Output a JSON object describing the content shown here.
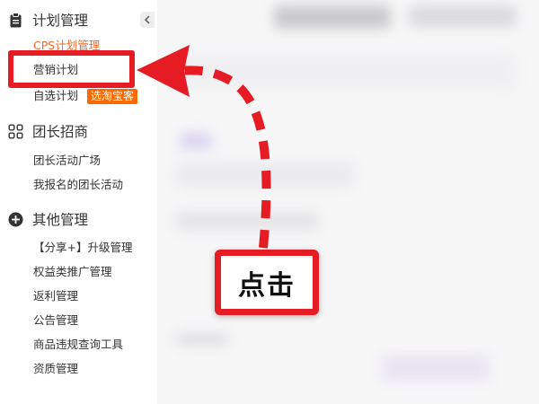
{
  "sidebar": {
    "sections": [
      {
        "title": "计划管理",
        "icon": "clipboard-icon",
        "items": [
          {
            "label": "CPS计划管理",
            "active": true
          },
          {
            "label": "营销计划",
            "highlighted": true
          },
          {
            "label": "自选计划",
            "tag": "选淘宝客"
          }
        ]
      },
      {
        "title": "团长招商",
        "icon": "grid-icon",
        "items": [
          {
            "label": "团长活动广场"
          },
          {
            "label": "我报名的团长活动"
          }
        ]
      },
      {
        "title": "其他管理",
        "icon": "plus-circle-icon",
        "items": [
          {
            "label": "【分享+】升级管理"
          },
          {
            "label": "权益类推广管理"
          },
          {
            "label": "返利管理"
          },
          {
            "label": "公告管理"
          },
          {
            "label": "商品违规查询工具"
          },
          {
            "label": "资质管理"
          }
        ]
      }
    ]
  },
  "annotation": {
    "callout_label": "点击",
    "color": "#e51c23"
  },
  "colors": {
    "active_item": "#f26b2a",
    "tag_bg": "#ff6a00"
  }
}
